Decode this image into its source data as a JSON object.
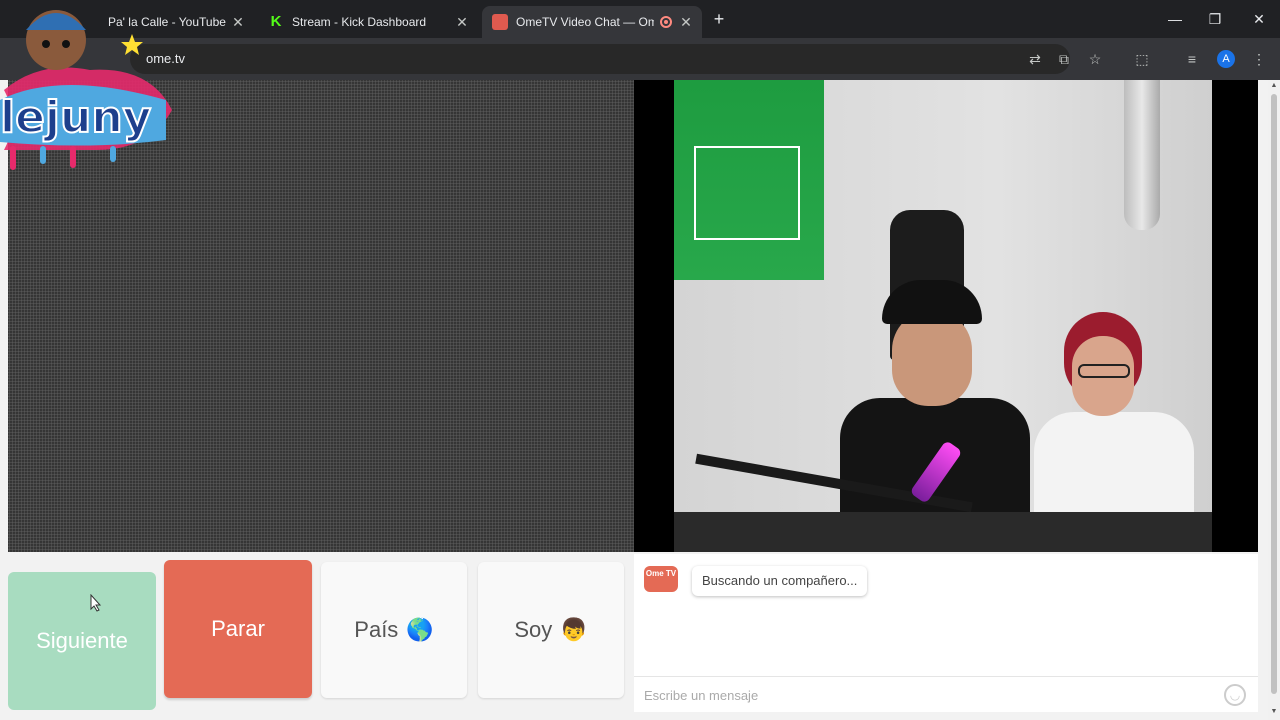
{
  "browser": {
    "tabs": [
      {
        "title": "Pa' la Calle - YouTube",
        "active": false
      },
      {
        "title": "Stream - Kick Dashboard",
        "active": false
      },
      {
        "title": "OmeTV Video Chat — Ome",
        "active": true
      }
    ],
    "url": "ome.tv",
    "profile_initial": "A",
    "icons": [
      "translate-icon",
      "install-app-icon",
      "bookmark-star-icon",
      "extensions-icon",
      "media-controls-icon",
      "menu-icon"
    ]
  },
  "overlay": {
    "logo_text": "lejuny"
  },
  "controls": {
    "next_label": "Siguiente",
    "stop_label": "Parar",
    "country_label": "País",
    "country_emoji": "🌎",
    "gender_label": "Soy",
    "gender_emoji": "👦"
  },
  "chat": {
    "logo_text": "Ome TV",
    "status_message": "Buscando un compañero...",
    "input_placeholder": "Escribe un mensaje"
  },
  "colors": {
    "next_button": "#a8dcc0",
    "stop_button": "#e46a55",
    "accent": "#e46a55"
  }
}
